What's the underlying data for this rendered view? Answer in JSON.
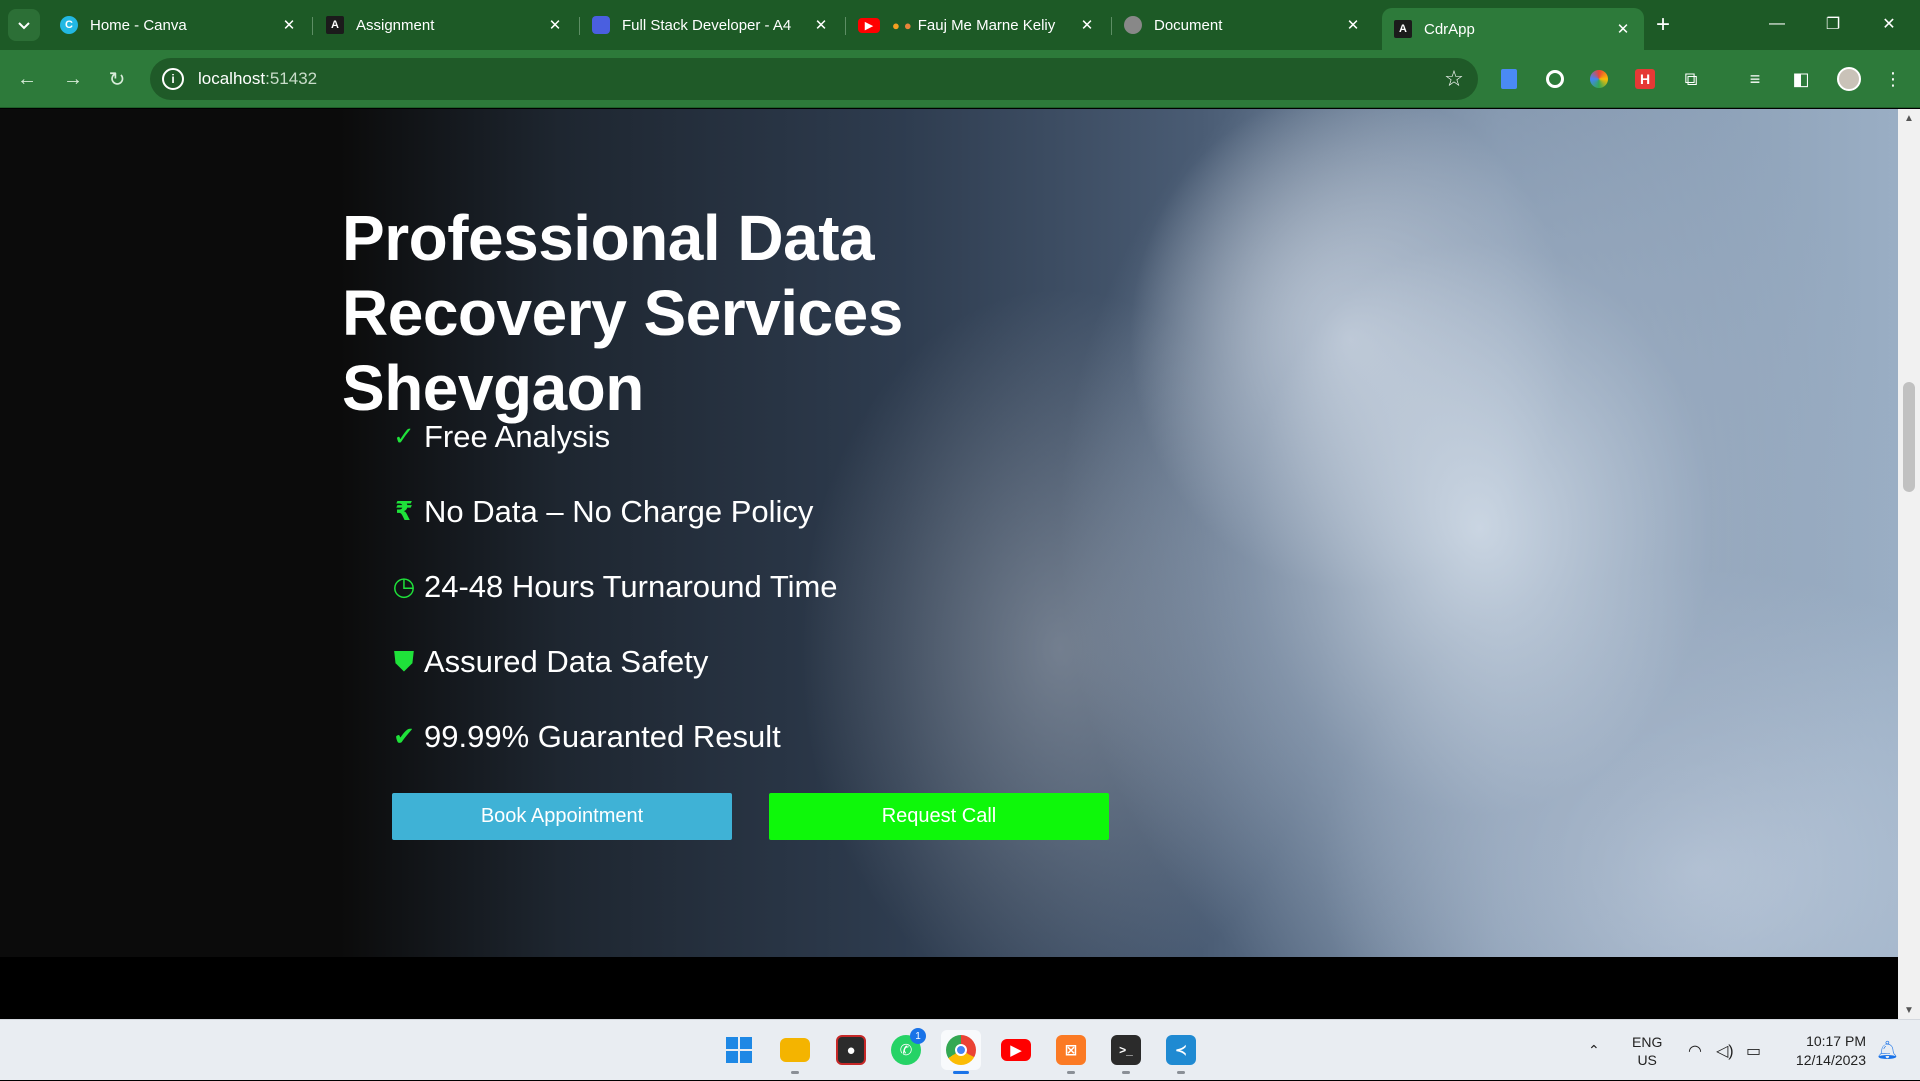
{
  "browser": {
    "tabs": [
      {
        "title": "Home - Canva",
        "favicon": "canva-icon",
        "color": "#22b8e3",
        "active": false
      },
      {
        "title": "Assignment",
        "favicon": "angular-a-icon",
        "color": "#1b1b1b",
        "active": false
      },
      {
        "title": "Full Stack Developer - A4",
        "favicon": "document-app-icon",
        "color": "#4a5fe0",
        "active": false
      },
      {
        "title": "Fauj Me Marne Keliy",
        "favicon": "youtube-icon",
        "color": "#ff0000",
        "active": false
      },
      {
        "title": "Document",
        "favicon": "globe-icon",
        "color": "#888888",
        "active": false
      },
      {
        "title": "CdrApp",
        "favicon": "angular-a-icon",
        "color": "#1b1b1b",
        "active": true
      }
    ],
    "address": {
      "host": "localhost",
      "port": ":51432"
    },
    "theme_color": "#2d7a3a"
  },
  "hero": {
    "title": "Professional Data Recovery Services Shevgaon",
    "features": [
      {
        "icon": "check-icon",
        "glyph": "✓",
        "text": "Free Analysis"
      },
      {
        "icon": "rupee-icon",
        "glyph": "₹",
        "text": "No Data – No Charge Policy"
      },
      {
        "icon": "clock-icon",
        "glyph": "◷",
        "text": "24-48 Hours Turnaround Time"
      },
      {
        "icon": "shield-icon",
        "glyph": "⛊",
        "text": "Assured Data Safety"
      },
      {
        "icon": "double-check-icon",
        "glyph": "✔",
        "text": "99.99% Guaranted Result"
      }
    ],
    "buttons": {
      "book": {
        "label": "Book Appointment",
        "color": "#3fb2d6"
      },
      "call": {
        "label": "Request Call",
        "color": "#0ef80a"
      }
    },
    "accent": "#1fe23a"
  },
  "taskbar": {
    "apps": [
      {
        "name": "windows-start-icon",
        "color": "#1e88e5"
      },
      {
        "name": "file-explorer-icon",
        "color": "#f4b400"
      },
      {
        "name": "screen-recorder-icon",
        "color": "#c62828"
      },
      {
        "name": "whatsapp-icon",
        "color": "#25d366",
        "badge": "1"
      },
      {
        "name": "chrome-icon",
        "color": "#4285f4"
      },
      {
        "name": "youtube-icon",
        "color": "#ff0000"
      },
      {
        "name": "xampp-icon",
        "color": "#fb7a24"
      },
      {
        "name": "terminal-icon",
        "color": "#2b2b2b"
      },
      {
        "name": "vscode-icon",
        "color": "#1f8ad2"
      }
    ],
    "language": {
      "line1": "ENG",
      "line2": "US"
    },
    "time": "10:17 PM",
    "date": "12/14/2023"
  }
}
